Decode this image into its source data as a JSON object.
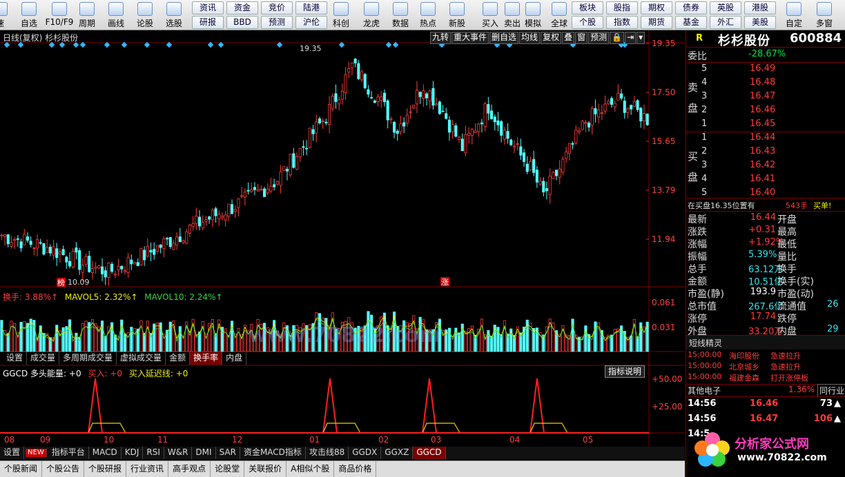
{
  "toolbar": {
    "buttons": [
      {
        "label": "速",
        "icon": "speed-icon"
      },
      {
        "label": "自选",
        "icon": "star-icon"
      },
      {
        "label": "F10/F9",
        "icon": "doc-icon"
      },
      {
        "label": "周期",
        "icon": "cycle-icon"
      },
      {
        "label": "画线",
        "icon": "pencil-icon"
      },
      {
        "label": "论股",
        "icon": "discuss-icon"
      },
      {
        "label": "选股",
        "icon": "select-icon"
      }
    ],
    "mid_buttons": [
      {
        "label": "科创",
        "icon": "chart-icon"
      },
      {
        "label": "龙虎",
        "icon": "dragon-icon"
      },
      {
        "label": "数据",
        "icon": "pe-icon"
      },
      {
        "label": "热点",
        "icon": "hot-icon"
      },
      {
        "label": "新股",
        "icon": "ipo-icon"
      },
      {
        "label": "买入",
        "icon": "buy-icon"
      },
      {
        "label": "卖出",
        "icon": "sell-icon"
      },
      {
        "label": "模拟",
        "icon": "hammer-icon"
      },
      {
        "label": "全球",
        "icon": "globe-icon"
      }
    ],
    "grid_a": [
      [
        "资讯",
        "资金",
        "竞价",
        "陆港"
      ],
      [
        "研报",
        "BBD",
        "预测",
        "沪伦"
      ]
    ],
    "grid_b": [
      [
        "板块",
        "股指",
        "期权",
        "债券",
        "英股",
        "港股"
      ],
      [
        "个股",
        "指数",
        "期货",
        "基金",
        "外汇",
        "美股"
      ]
    ],
    "tail": [
      {
        "label": "自定",
        "icon": "custom-icon"
      },
      {
        "label": "多窗",
        "icon": "window-icon"
      }
    ]
  },
  "chart": {
    "title": "日线(复权)  杉杉股份",
    "menu": [
      "九转",
      "重大事件",
      "删自选",
      "均线",
      "复权",
      "叠",
      "窗",
      "预测",
      "🔒",
      "⇥",
      "▾"
    ],
    "price_axis": [
      "19.35",
      "17.50",
      "15.65",
      "13.79",
      "11.94"
    ],
    "high_label": "19.35",
    "low_label": "10.09",
    "bang_label": "榜",
    "zhang_label": "涨",
    "vol_header": {
      "hs": "换手: 3.88%↑",
      "m5": "MAVOL5: 2.32%↑",
      "m10": "MAVOL10: 2.24%↑"
    },
    "vol_axis": [
      "0.061",
      "0.031"
    ],
    "vol_tabs": [
      "设置",
      "成交量",
      "多周期成交量",
      "虚拟成交量",
      "金额",
      "换手率",
      "内盘"
    ],
    "ind_header": {
      "name": "GGCD",
      "dt": "多头能量: +0",
      "buy": "买入: +0",
      "ext": "买入延迟线: +0"
    },
    "ind_btn": "指标说明",
    "ind_axis": [
      "+50.00",
      "+25.00"
    ],
    "months": [
      "08",
      "09",
      "10",
      "11",
      "12",
      "01",
      "02",
      "03",
      "04",
      "05"
    ],
    "ind_tabs": [
      "设置",
      "NEW",
      "指标平台",
      "MACD",
      "KDJ",
      "RSI",
      "W&R",
      "DMI",
      "SAR",
      "资金MACD指标",
      "攻击线88",
      "GGDX",
      "GGXZ",
      "GGCD"
    ],
    "bottom_tabs": [
      "个股新闻",
      "个股公告",
      "个股研报",
      "行业资讯",
      "高手观点",
      "论股堂",
      "关联报价",
      "A相似个股",
      "商品价格"
    ]
  },
  "quote": {
    "r": "R",
    "name": "杉杉股份",
    "code": "600884",
    "wb_label": "委比",
    "wb": "-28.67%",
    "sell_side": "卖盘",
    "buy_side": "买盘",
    "sell": [
      [
        "5",
        "16.49"
      ],
      [
        "4",
        "16.48"
      ],
      [
        "3",
        "16.47"
      ],
      [
        "2",
        "16.46"
      ],
      [
        "1",
        "16.45"
      ]
    ],
    "buy": [
      [
        "1",
        "16.44"
      ],
      [
        "2",
        "16.43"
      ],
      [
        "3",
        "16.42"
      ],
      [
        "4",
        "16.41"
      ],
      [
        "5",
        "16.40"
      ]
    ],
    "notice": "在买盘16.35位置有",
    "notice_qty": "543手",
    "notice_tag": "买单!",
    "stats": [
      [
        "最新",
        "16.44",
        "red",
        "开盘",
        ""
      ],
      [
        "涨跌",
        "+0.31",
        "red",
        "最高",
        ""
      ],
      [
        "涨幅",
        "+1.92%",
        "red",
        "最低",
        ""
      ],
      [
        "振幅",
        "5.39%",
        "cyn",
        "量比",
        ""
      ],
      [
        "总手",
        "63.12万",
        "cyn",
        "换手",
        ""
      ],
      [
        "金额",
        "10.51亿",
        "cyn",
        "换手(实)",
        ""
      ],
      [
        "市盈(静)",
        "193.9",
        "wht",
        "市盈(动)",
        ""
      ],
      [
        "总市值",
        "267.6亿",
        "cyn",
        "流通值",
        "26"
      ],
      [
        "涨停",
        "17.74",
        "red",
        "跌停",
        ""
      ],
      [
        "外盘",
        "33.20万",
        "red",
        "内盘",
        "29"
      ]
    ],
    "sprite_title": "短线精灵",
    "sprites": [
      [
        "15:00:00",
        "海印股份",
        "急速拉升"
      ],
      [
        "15:00:00",
        "北京城乡",
        "急速拉升"
      ],
      [
        "15:00:00",
        "福建金森",
        "打开涨停板"
      ]
    ],
    "sector_name": "其他电子",
    "sector_pct": "1.36%",
    "sector_btn": "同行业",
    "ticks": [
      [
        "14:56",
        "16.46",
        "73",
        "up"
      ],
      [
        "14:56",
        "16.47",
        "106",
        "up"
      ],
      [
        "14:5",
        "",
        " ",
        ""
      ]
    ]
  },
  "watermark": {
    "brand": "分析家公式网",
    "url": "www.70822.com"
  }
}
